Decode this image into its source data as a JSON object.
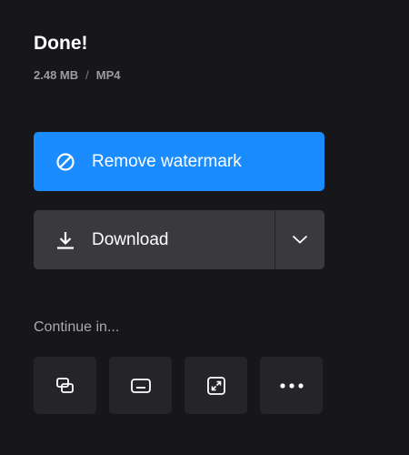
{
  "header": {
    "title": "Done!",
    "file_size": "2.48 MB",
    "separator": "/",
    "file_format": "MP4"
  },
  "actions": {
    "remove_watermark_label": "Remove watermark",
    "download_label": "Download"
  },
  "continue": {
    "label": "Continue in...",
    "tools": [
      {
        "icon": "layers-icon"
      },
      {
        "icon": "subtitle-icon"
      },
      {
        "icon": "resize-icon"
      },
      {
        "icon": "more-icon"
      }
    ]
  },
  "colors": {
    "background": "#17161a",
    "primary": "#1a8cff",
    "secondary_button": "#3a393e",
    "tool_button": "#252429"
  }
}
